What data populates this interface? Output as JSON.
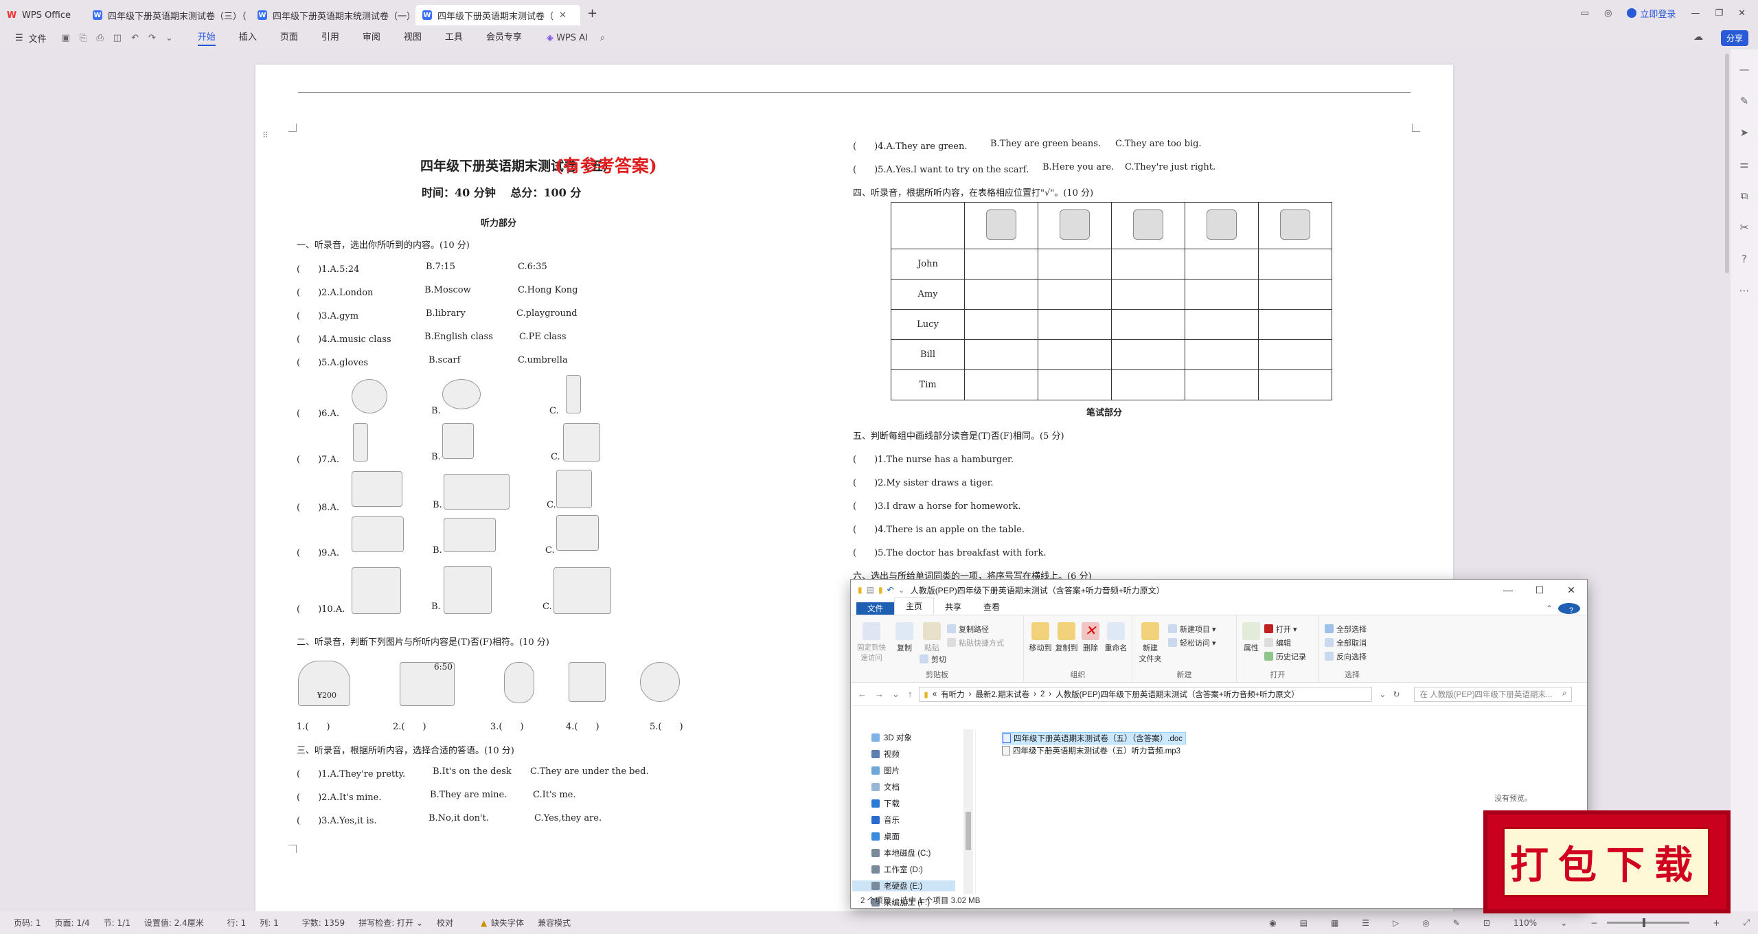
{
  "tabs": [
    {
      "label": "WPS Office",
      "kind": "home"
    },
    {
      "label": "四年级下册英语期末测试卷（三）（",
      "kind": "doc"
    },
    {
      "label": "四年级下册英语期末统测试卷（一）",
      "kind": "doc"
    },
    {
      "label": "四年级下册英语期末测试卷（",
      "kind": "doc",
      "active": true
    }
  ],
  "titlebar": {
    "login": "立即登录"
  },
  "ribbon": {
    "file": "文件",
    "menu": [
      "开始",
      "插入",
      "页面",
      "引用",
      "审阅",
      "视图",
      "工具",
      "会员专享"
    ],
    "ai": "WPS AI",
    "share": "分享"
  },
  "doc": {
    "title": "四年级下册英语期末测试卷（五）",
    "answer_tag": "(有参考答案)",
    "meta": "时间：40 分钟　 总分：100 分",
    "listening": "听力部分",
    "sec1": "一、听录音，选出你所听到的内容。(10 分)",
    "q1": [
      {
        "n": "(　　)1.A.5:24",
        "b": "B.7:15",
        "c": "C.6:35"
      },
      {
        "n": "(　　)2.A.London",
        "b": "B.Moscow",
        "c": "C.Hong Kong"
      },
      {
        "n": "(　　)3.A.gym",
        "b": "B.library",
        "c": "C.playground"
      },
      {
        "n": "(　　)4.A.music class",
        "b": "B.English class",
        "c": "C.PE class"
      },
      {
        "n": "(　　)5.A.gloves",
        "b": "B.scarf",
        "c": "C.umbrella"
      }
    ],
    "q6": [
      {
        "n": "(　　)6.A.",
        "b": "B.",
        "c": "C."
      },
      {
        "n": "(　　)7.A.",
        "b": "B.",
        "c": "C."
      },
      {
        "n": "(　　)8.A.",
        "b": "B.",
        "c": "C."
      },
      {
        "n": "(　　)9.A.",
        "b": "B.",
        "c": "C."
      },
      {
        "n": "(　　)10.A.",
        "b": "B.",
        "c": "C."
      }
    ],
    "sec2": "二、听录音，判断下列图片与所听内容是(T)否(F)相符。(10 分)",
    "sec2_pic_labels": [
      "¥200",
      "6:50"
    ],
    "sec2_items": [
      "1.(　　)",
      "2.(　　)",
      "3.(　　)",
      "4.(　　)",
      "5.(　　)"
    ],
    "sec3": "三、听录音，根据所听内容，选择合适的答语。(10 分)",
    "q3": [
      {
        "n": "(　　)1.A.They're pretty.",
        "b": "B.It's on the desk",
        "c": "C.They are under the bed."
      },
      {
        "n": "(　　)2.A.It's mine.",
        "b": "B.They are mine.",
        "c": "C.It's me."
      },
      {
        "n": "(　　)3.A.Yes,it is.",
        "b": "B.No,it don't.",
        "c": "C.Yes,they are."
      },
      {
        "n": "(　　)4.A.They are green.",
        "b": "B.They are green beans.",
        "c": "C.They are too big."
      },
      {
        "n": "(　　)5.A.Yes.I want to try on the scarf.",
        "b": "B.Here you are.",
        "c": "C.They're just right."
      }
    ],
    "sec4": "四、听录音，根据所听内容，在表格相应位置打\"√\"。(10 分)",
    "grid_names": [
      "John",
      "Amy",
      "Lucy",
      "Bill",
      "Tim"
    ],
    "written": "笔试部分",
    "sec5": "五、判断每组中画线部分读音是(T)否(F)相同。(5 分)",
    "q5": [
      "(　　)1.The nurse has a hamburger.",
      "(　　)2.My sister draws a tiger.",
      "(　　)3.I draw a horse for homework.",
      "(　　)4.There is an apple on the table.",
      "(　　)5.The doctor has breakfast with fork."
    ],
    "sec6_partial": "六、选出与所给单词同类的一项，将序号写在横线上。(6 分)"
  },
  "explorer": {
    "title": "人教版(PEP)四年级下册英语期末测试（含答案+听力音频+听力原文）",
    "tabs": [
      "文件",
      "主页",
      "共享",
      "查看"
    ],
    "ribbon": {
      "pin": "固定到快\n速访问",
      "copy": "复制",
      "paste": "粘贴",
      "copy_path": "复制路径",
      "paste_shortcut": "粘贴快捷方式",
      "cut": "剪切",
      "clipboard": "剪贴板",
      "move_to": "移动到",
      "copy_to": "复制到",
      "delete": "删除",
      "rename": "重命名",
      "organize": "组织",
      "new_folder": "新建\n文件夹",
      "new_item": "新建项目",
      "easy_access": "轻松访问",
      "new": "新建",
      "properties": "属性",
      "open": "打开",
      "edit": "编辑",
      "history": "历史记录",
      "open_grp": "打开",
      "select_all": "全部选择",
      "select_none": "全部取消",
      "invert": "反向选择",
      "select": "选择"
    },
    "path": [
      "有听力",
      "最新2.期末试卷",
      "2",
      "人教版(PEP)四年级下册英语期末测试（含答案+听力音频+听力原文）"
    ],
    "search_placeholder": "在 人教版(PEP)四年级下册英语期末...",
    "nav": [
      "3D 对象",
      "视频",
      "图片",
      "文档",
      "下载",
      "音乐",
      "桌面",
      "本地磁盘 (C:)",
      "工作室 (D:)",
      "老硬盘 (E:)",
      "采编加工 (F:)"
    ],
    "files": [
      {
        "name": "四年级下册英语期末测试卷（五）（含答案）.doc",
        "selected": true
      },
      {
        "name": "四年级下册英语期末测试卷（五）听力音频.mp3",
        "selected": false
      }
    ],
    "preview": "没有预览。",
    "status": [
      "2 个项目",
      "选中 1 个项目 3.02 MB"
    ]
  },
  "badge": "打包下载",
  "statusbar": {
    "page": "页码: 1",
    "pages": "页面: 1/4",
    "section": "节: 1/1",
    "setting": "设置值: 2.4厘米",
    "row": "行: 1",
    "col": "列: 1",
    "words": "字数: 1359",
    "spell": "拼写检查: 打开 ⌄",
    "proof": "校对",
    "font_missing": "缺失字体",
    "compat": "兼容模式",
    "zoom": "110%"
  }
}
